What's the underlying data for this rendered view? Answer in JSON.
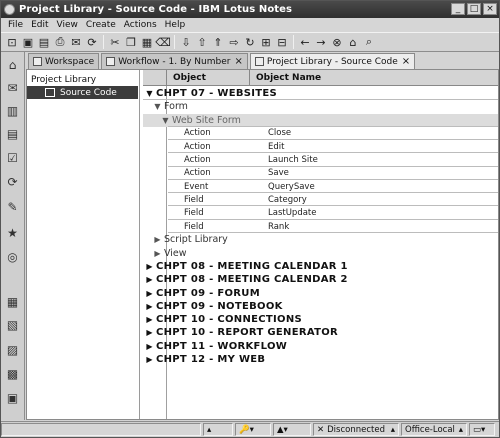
{
  "window": {
    "title": "Project Library - Source Code - IBM Lotus Notes"
  },
  "menu": [
    "File",
    "Edit",
    "View",
    "Create",
    "Actions",
    "Help"
  ],
  "toolbar_icons": [
    "open-icon",
    "save-icon",
    "folder-icon",
    "print-icon",
    "mail-icon",
    "replicate-icon",
    "sep",
    "cut-icon",
    "copy-icon",
    "paste-icon",
    "delete-icon",
    "sep",
    "arrow-down-icon",
    "arrow-up-icon",
    "arrow-up-alt-icon",
    "arrow-forward-icon",
    "refresh-icon",
    "expand-icon",
    "collapse-icon",
    "sep",
    "back-icon",
    "forward-icon",
    "stop-icon",
    "home-icon",
    "search-icon"
  ],
  "tabs": [
    {
      "label": "Workspace",
      "active": false,
      "closable": false
    },
    {
      "label": "Workflow - 1. By Number",
      "active": false,
      "closable": true
    },
    {
      "label": "Project Library - Source Code",
      "active": true,
      "closable": true
    }
  ],
  "nav": [
    {
      "label": "Project Library",
      "selected": false,
      "indent": 0,
      "icon": false
    },
    {
      "label": "Source Code",
      "selected": true,
      "indent": 14,
      "icon": true
    }
  ],
  "columns": [
    "Object",
    "Object Name"
  ],
  "rows": [
    {
      "type": "cat1",
      "twisty": "open",
      "indent": 0,
      "text": "CHPT 07 - WEBSITES"
    },
    {
      "type": "cat2",
      "twisty": "open",
      "indent": 8,
      "text": "Form"
    },
    {
      "type": "cat2",
      "twisty": "open",
      "indent": 16,
      "text": "Web Site Form",
      "highlight": true
    },
    {
      "type": "doc",
      "object": "Action",
      "name": "Close"
    },
    {
      "type": "doc",
      "object": "Action",
      "name": "Edit"
    },
    {
      "type": "doc",
      "object": "Action",
      "name": "Launch Site"
    },
    {
      "type": "doc",
      "object": "Action",
      "name": "Save"
    },
    {
      "type": "doc",
      "object": "Event",
      "name": "QuerySave"
    },
    {
      "type": "doc",
      "object": "Field",
      "name": "Category"
    },
    {
      "type": "doc",
      "object": "Field",
      "name": "LastUpdate"
    },
    {
      "type": "doc",
      "object": "Field",
      "name": "Rank"
    },
    {
      "type": "cat2",
      "twisty": "closed",
      "indent": 8,
      "text": "Script Library"
    },
    {
      "type": "cat2",
      "twisty": "closed",
      "indent": 8,
      "text": "View"
    },
    {
      "type": "cat1",
      "twisty": "closed",
      "indent": 0,
      "text": "CHPT 08 - MEETING CALENDAR 1"
    },
    {
      "type": "cat1",
      "twisty": "closed",
      "indent": 0,
      "text": "CHPT 08 - MEETING CALENDAR 2"
    },
    {
      "type": "cat1",
      "twisty": "closed",
      "indent": 0,
      "text": "CHPT 09 - FORUM"
    },
    {
      "type": "cat1",
      "twisty": "closed",
      "indent": 0,
      "text": "CHPT 09 - NOTEBOOK"
    },
    {
      "type": "cat1",
      "twisty": "closed",
      "indent": 0,
      "text": "CHPT 10 - CONNECTIONS"
    },
    {
      "type": "cat1",
      "twisty": "closed",
      "indent": 0,
      "text": "CHPT 10 - REPORT GENERATOR"
    },
    {
      "type": "cat1",
      "twisty": "closed",
      "indent": 0,
      "text": "CHPT 11 - WORKFLOW"
    },
    {
      "type": "cat1",
      "twisty": "closed",
      "indent": 0,
      "text": "CHPT 12 - MY WEB"
    }
  ],
  "status": {
    "connection": "Disconnected",
    "location": "Office-Local"
  },
  "left_bookmarks": [
    "home-icon",
    "mail-icon",
    "calendar-icon",
    "address-book-icon",
    "todo-icon",
    "replicator-icon",
    "discussion-icon",
    "favorites-icon",
    "web-icon",
    "database-icon",
    "applications-icon",
    "folder-icon",
    "recent-icon",
    "more-icon"
  ]
}
